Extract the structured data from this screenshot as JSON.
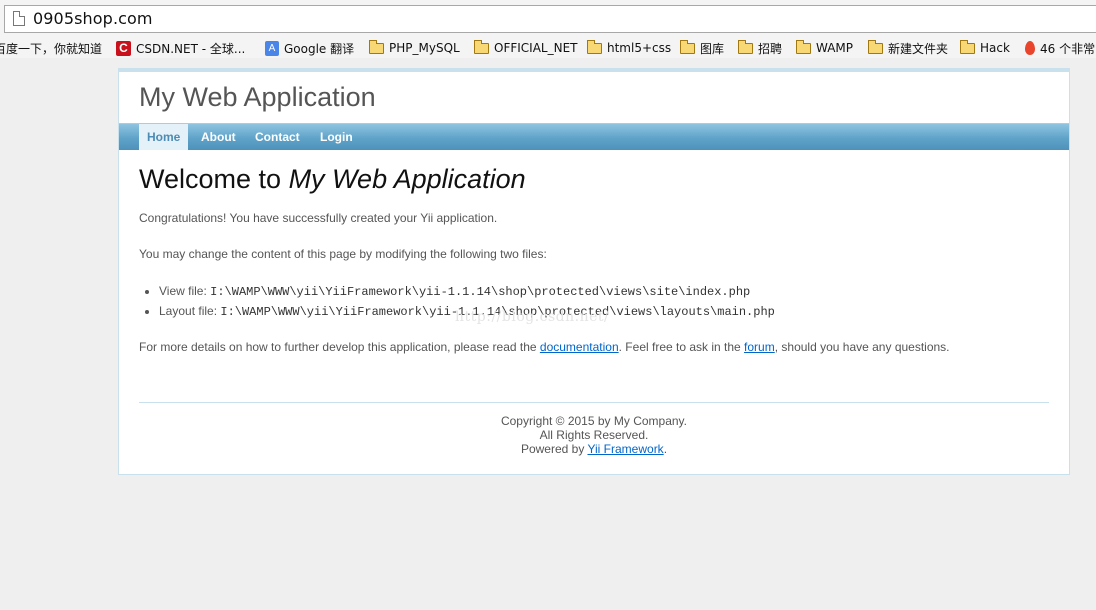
{
  "browser": {
    "url": "0905shop.com",
    "bookmarks": [
      {
        "label": "百度一下，你就知道",
        "icon": "none"
      },
      {
        "label": "CSDN.NET - 全球...",
        "icon": "csdn-icon"
      },
      {
        "label": "Google 翻译",
        "icon": "google-translate-icon"
      },
      {
        "label": "PHP_MySQL",
        "icon": "folder-icon"
      },
      {
        "label": "OFFICIAL_NET",
        "icon": "folder-icon"
      },
      {
        "label": "html5+css",
        "icon": "folder-icon"
      },
      {
        "label": "图库",
        "icon": "folder-icon"
      },
      {
        "label": "招聘",
        "icon": "folder-icon"
      },
      {
        "label": "WAMP",
        "icon": "folder-icon"
      },
      {
        "label": "新建文件夹",
        "icon": "folder-icon"
      },
      {
        "label": "Hack",
        "icon": "folder-icon"
      },
      {
        "label": "46 个非常",
        "icon": "fire-icon"
      }
    ]
  },
  "site": {
    "logo": "My Web Application",
    "menu": [
      {
        "label": "Home",
        "active": true
      },
      {
        "label": "About",
        "active": false
      },
      {
        "label": "Contact",
        "active": false
      },
      {
        "label": "Login",
        "active": false
      }
    ]
  },
  "content": {
    "heading_prefix": "Welcome to ",
    "heading_name": "My Web Application",
    "congrats": "Congratulations! You have successfully created your Yii application.",
    "change_intro": "You may change the content of this page by modifying the following two files:",
    "files": [
      {
        "label": "View file: ",
        "path": "I:\\WAMP\\WWW\\yii\\YiiFramework\\yii-1.1.14\\shop\\protected\\views\\site\\index.php"
      },
      {
        "label": "Layout file: ",
        "path": "I:\\WAMP\\WWW\\yii\\YiiFramework\\yii-1.1.14\\shop\\protected\\views\\layouts\\main.php"
      }
    ],
    "details_before": "For more details on how to further develop this application, please read the ",
    "details_link": "documentation",
    "details_middle": ". Feel free to ask in the ",
    "forum_link": "forum",
    "details_after": ", should you have any questions."
  },
  "watermark": "http://blog.csdn.net/",
  "footer": {
    "copyright": "Copyright © 2015 by My Company.",
    "rights": "All Rights Reserved.",
    "powered_prefix": "Powered by ",
    "powered_link": "Yii Framework",
    "powered_suffix": "."
  },
  "colors": {
    "menu_bar": "#5fa3c9",
    "link": "#0066cc",
    "border": "#c9e0ed"
  }
}
